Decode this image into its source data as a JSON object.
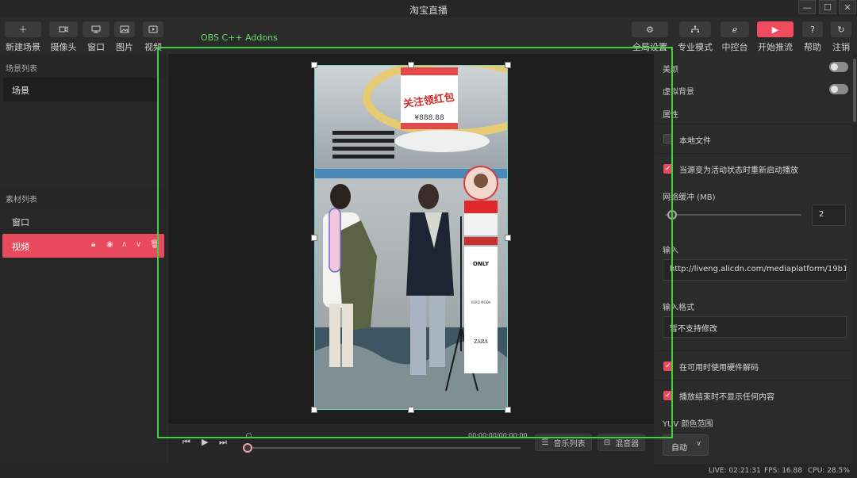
{
  "window": {
    "title": "淘宝直播",
    "min": "—",
    "max": "☐",
    "close": "✕"
  },
  "toolbar": {
    "new_scene": "新建场景",
    "camera": "摄像头",
    "window": "窗口",
    "image": "图片",
    "video": "视频",
    "global_settings": "全局设置",
    "pro_mode": "专业模式",
    "console": "中控台",
    "start_stream": "开始推流",
    "help": "帮助",
    "logout": "注销"
  },
  "overlay": {
    "label": "OBS C++ Addons"
  },
  "left": {
    "scene_header": "场景列表",
    "scene": "场景",
    "source_header": "素材列表",
    "sources": [
      {
        "label": "窗口"
      },
      {
        "label": "视频"
      }
    ]
  },
  "transport": {
    "timecode": "00:00:00/00:00:00",
    "music_list": "音乐列表",
    "mixer": "混音器"
  },
  "right": {
    "beauty": "美颜",
    "virtual_bg": "虚拟背景",
    "properties": "属性",
    "local_file": "本地文件",
    "restart_on_active": "当源变为活动状态时重新启动播放",
    "network_buffer": "网络缓冲 (MB)",
    "buffer_value": "2",
    "input": "输入",
    "input_value": "http://liveng.alicdn.com/mediaplatform/19b18",
    "input_format": "输入格式",
    "input_format_value": "暂不支持修改",
    "hw_decode": "在可用时使用硬件解码",
    "hide_on_end": "播放结束时不显示任何内容",
    "yuv_range": "YUV 颜色范围",
    "yuv_value": "自动"
  },
  "stream_video": {
    "coupon_title": "关注领红包",
    "coupon_amount": "¥888.88",
    "brands": [
      "ONLY",
      "VERO MODA",
      "ZARA"
    ]
  },
  "status": {
    "live": "LIVE: 02:21:31",
    "fps": "FPS: 16.88",
    "cpu": "CPU: 28.5%"
  }
}
